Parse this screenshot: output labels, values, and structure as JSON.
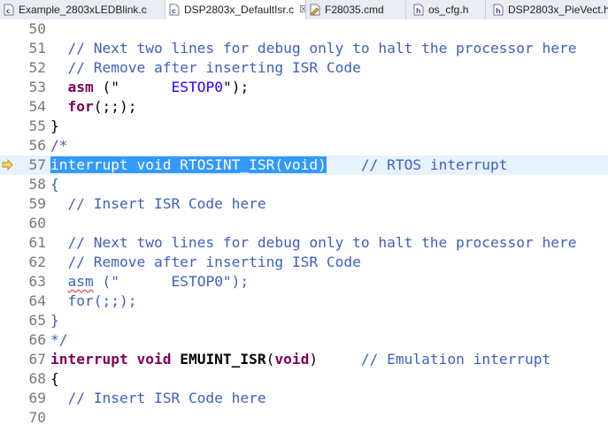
{
  "tabs": [
    {
      "label": "Example_2803xLEDBlink.c",
      "icon": "c-file-icon"
    },
    {
      "label": "DSP2803x_DefaultIsr.c",
      "icon": "c-file-icon",
      "active": true,
      "close": "☒"
    },
    {
      "label": "F28035.cmd",
      "icon": "linker-cmd-file-icon"
    },
    {
      "label": "os_cfg.h",
      "icon": "h-file-icon"
    },
    {
      "label": "DSP2803x_PieVect.h",
      "icon": "h-file-icon"
    }
  ],
  "lines": [
    {
      "n": "50",
      "fold": "",
      "parts": []
    },
    {
      "n": "51",
      "fold": "",
      "parts": [
        {
          "t": "  "
        },
        {
          "t": "// Next two lines for debug only to halt the processor here",
          "c": "cm"
        }
      ]
    },
    {
      "n": "52",
      "fold": "",
      "parts": [
        {
          "t": "  "
        },
        {
          "t": "// Remove after inserting ISR Code",
          "c": "cm"
        }
      ]
    },
    {
      "n": "53",
      "fold": "",
      "parts": [
        {
          "t": "  "
        },
        {
          "t": "asm",
          "c": "kw"
        },
        {
          "t": " (\"      "
        },
        {
          "t": "ESTOP0",
          "c": "str"
        },
        {
          "t": "\");"
        }
      ]
    },
    {
      "n": "54",
      "fold": "",
      "parts": [
        {
          "t": "  "
        },
        {
          "t": "for",
          "c": "kw"
        },
        {
          "t": "(;;);"
        }
      ]
    },
    {
      "n": "55",
      "fold": "",
      "parts": [
        {
          "t": "}"
        }
      ]
    },
    {
      "n": "56",
      "fold": "⊖",
      "parts": [
        {
          "t": "/*",
          "c": "cm"
        }
      ]
    },
    {
      "n": "57",
      "fold": "",
      "current": true,
      "marker": "arrow",
      "parts": [
        {
          "t": "interrupt void RTOSINT_ISR(void)",
          "c": "sel"
        },
        {
          "t": "    "
        },
        {
          "t": "// RTOS interrupt",
          "c": "cm"
        }
      ]
    },
    {
      "n": "58",
      "fold": "⊖",
      "parts": [
        {
          "t": "{",
          "c": "cm"
        }
      ]
    },
    {
      "n": "59",
      "fold": "",
      "parts": [
        {
          "t": "  // Insert ISR Code here",
          "c": "cm"
        }
      ]
    },
    {
      "n": "60",
      "fold": "",
      "parts": []
    },
    {
      "n": "61",
      "fold": "",
      "parts": [
        {
          "t": "  // Next two lines for debug only to halt the processor here",
          "c": "cm"
        }
      ]
    },
    {
      "n": "62",
      "fold": "",
      "parts": [
        {
          "t": "  // Remove after inserting ISR Code",
          "c": "cm"
        }
      ]
    },
    {
      "n": "63",
      "fold": "",
      "parts": [
        {
          "t": "  ",
          "c": "cm"
        },
        {
          "t": "asm",
          "c": "cm squig"
        },
        {
          "t": " (\"      ESTOP0\");",
          "c": "cm"
        }
      ]
    },
    {
      "n": "64",
      "fold": "",
      "parts": [
        {
          "t": "  for(;;);",
          "c": "cm"
        }
      ]
    },
    {
      "n": "65",
      "fold": "",
      "parts": [
        {
          "t": "}",
          "c": "cm"
        }
      ]
    },
    {
      "n": "66",
      "fold": "⊖",
      "parts": [
        {
          "t": "*/",
          "c": "cm"
        }
      ]
    },
    {
      "n": "67",
      "fold": "⊖",
      "parts": [
        {
          "t": "interrupt void",
          "c": "kw"
        },
        {
          "t": " "
        },
        {
          "t": "EMUINT_ISR",
          "c": "fnb"
        },
        {
          "t": "("
        },
        {
          "t": "void",
          "c": "kw"
        },
        {
          "t": ")     "
        },
        {
          "t": "// Emulation interrupt",
          "c": "cm"
        }
      ]
    },
    {
      "n": "68",
      "fold": "⊖",
      "parts": [
        {
          "t": "{"
        }
      ]
    },
    {
      "n": "69",
      "fold": "",
      "parts": [
        {
          "t": "  "
        },
        {
          "t": "// Insert ISR Code here",
          "c": "cm"
        }
      ]
    },
    {
      "n": "70",
      "fold": "",
      "parts": []
    }
  ]
}
